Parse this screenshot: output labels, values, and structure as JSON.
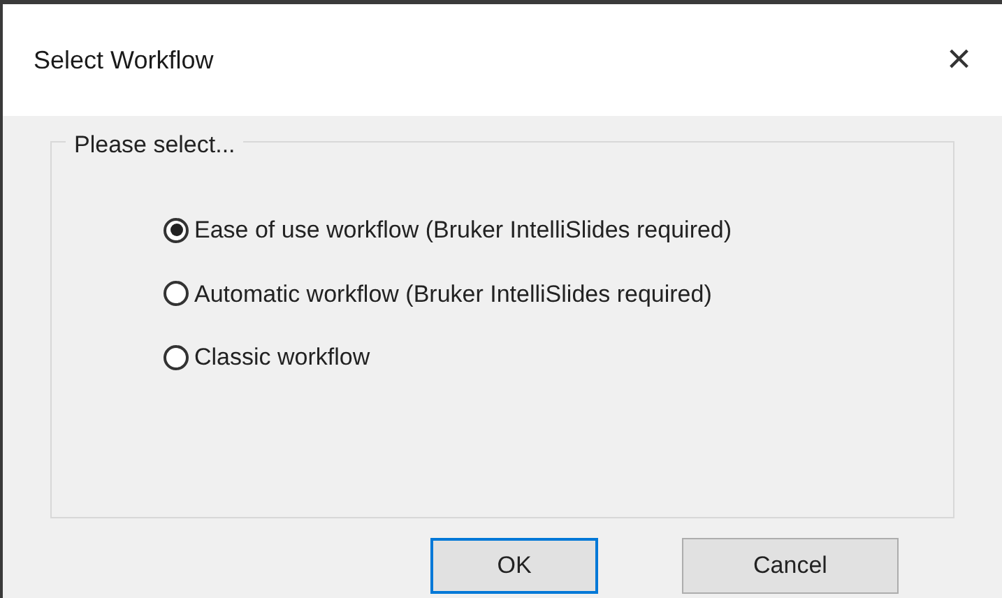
{
  "window": {
    "title": "Select Workflow",
    "close": "×"
  },
  "group": {
    "label": "Please select...",
    "options": [
      {
        "label": "Ease of use workflow (Bruker IntelliSlides required)",
        "selected": true
      },
      {
        "label": "Automatic workflow (Bruker IntelliSlides required)",
        "selected": false
      },
      {
        "label": "Classic workflow",
        "selected": false
      }
    ]
  },
  "buttons": [
    {
      "label": "OK",
      "kind": "default"
    },
    {
      "label": "Cancel",
      "kind": "normal"
    }
  ]
}
